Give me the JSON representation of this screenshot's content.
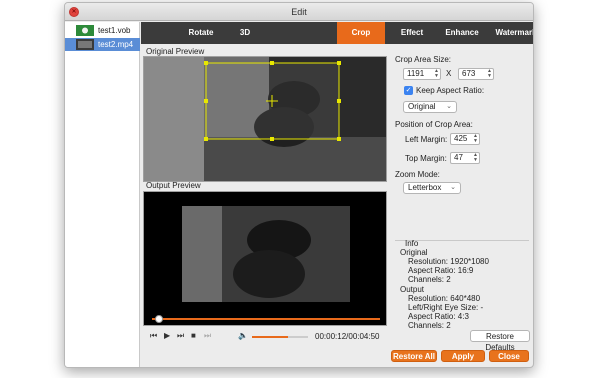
{
  "window": {
    "title": "Edit"
  },
  "files": [
    {
      "name": "test1.vob",
      "selected": false
    },
    {
      "name": "test2.mp4",
      "selected": true
    }
  ],
  "tabs": [
    "Rotate",
    "3D",
    "Crop",
    "Effect",
    "Enhance",
    "Watermark"
  ],
  "active_tab": "Crop",
  "preview": {
    "original_label": "Original Preview",
    "output_label": "Output Preview"
  },
  "crop": {
    "area_size_label": "Crop Area Size:",
    "width": "1191",
    "x_label": "X",
    "height": "673",
    "keep_aspect_label": "Keep Aspect Ratio:",
    "keep_aspect_checked": true,
    "aspect_value": "Original",
    "position_label": "Position of Crop Area:",
    "left_margin_label": "Left Margin:",
    "left_margin": "425",
    "top_margin_label": "Top Margin:",
    "top_margin": "47",
    "zoom_mode_label": "Zoom Mode:",
    "zoom_mode": "Letterbox"
  },
  "info": {
    "title": "Info",
    "original_title": "Original",
    "orig_resolution": "Resolution: 1920*1080",
    "orig_aspect": "Aspect Ratio: 16:9",
    "orig_channels": "Channels: 2",
    "output_title": "Output",
    "out_resolution": "Resolution: 640*480",
    "out_eye_size": "Left/Right Eye Size: -",
    "out_aspect": "Aspect Ratio: 4:3",
    "out_channels": "Channels: 2"
  },
  "player": {
    "time": "00:00:12/00:04:50",
    "progress": 0.02,
    "volume": 0.65
  },
  "buttons": {
    "restore_defaults": "Restore Defaults",
    "restore_all": "Restore All",
    "apply": "Apply",
    "close": "Close"
  },
  "colors": {
    "accent": "#e86a1b",
    "tabbar": "#3b3b3b",
    "selection": "#5a8dd6",
    "checkbox": "#3b83f0"
  },
  "icons": [
    "close-icon",
    "video-thumb-icon",
    "prev-icon",
    "play-icon",
    "next-icon",
    "stop-icon",
    "volume-icon"
  ]
}
